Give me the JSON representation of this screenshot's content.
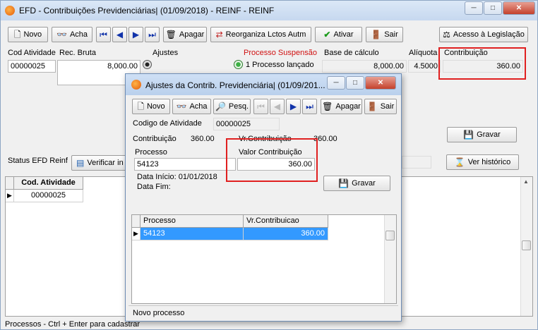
{
  "main": {
    "title": "EFD - Contribuições Previdenciárias| (01/09/2018) - REINF - REINF",
    "toolbar": {
      "novo": "Novo",
      "acha": "Acha",
      "apagar": "Apagar",
      "reorganiza": "Reorganiza Lctos Autm",
      "ativar": "Ativar",
      "sair": "Sair",
      "acesso": "Acesso à Legislação"
    },
    "labels": {
      "cod_atividade": "Cod Atividade",
      "rec_bruta": "Rec. Bruta",
      "ajustes": "Ajustes",
      "processo_suspensao": "Processo Suspensão",
      "base_calculo": "Base de cálculo",
      "aliquota": "Alíquota",
      "contribuicao": "Contribuição",
      "status_efd": "Status EFD Reinf"
    },
    "values": {
      "cod_atividade": "00000025",
      "rec_bruta": "8,000.00",
      "processo_lancado": "1 Processo lançado",
      "base_calculo": "8,000.00",
      "aliquota": "4.5000",
      "contribuicao": "360.00"
    },
    "gravar": "Gravar",
    "verificar": "Verificar in",
    "ver_historico": "Ver histórico",
    "grid": {
      "header": "Cod. Atividade",
      "rows": [
        "00000025"
      ]
    },
    "statusbar": "Processos - Ctrl + Enter para cadastrar"
  },
  "dialog": {
    "title": "Ajustes da Contrib. Previdenciária| (01/09/201...",
    "toolbar": {
      "novo": "Novo",
      "acha": "Acha",
      "pesq": "Pesq.",
      "apagar": "Apagar",
      "sair": "Sair"
    },
    "codigo_label": "Codigo de Atividade",
    "codigo_value": "00000025",
    "contrib_label": "Contribuição",
    "contrib_value": "360.00",
    "vrcontrib_label": "Vr.Contribuição",
    "vrcontrib_value": "360.00",
    "processo_label": "Processo",
    "processo_value": "54123",
    "valor_label": "Valor Contribuição",
    "valor_value": "360.00",
    "data_inicio": "Data Início: 01/01/2018",
    "data_fim": "Data Fim:",
    "gravar": "Gravar",
    "grid": {
      "headers": [
        "Processo",
        "Vr.Contribuicao"
      ],
      "rows": [
        [
          "54123",
          "360.00"
        ]
      ]
    },
    "status": "Novo processo"
  },
  "colors": {
    "highlight": "#e02020",
    "selection": "#3399ff"
  }
}
